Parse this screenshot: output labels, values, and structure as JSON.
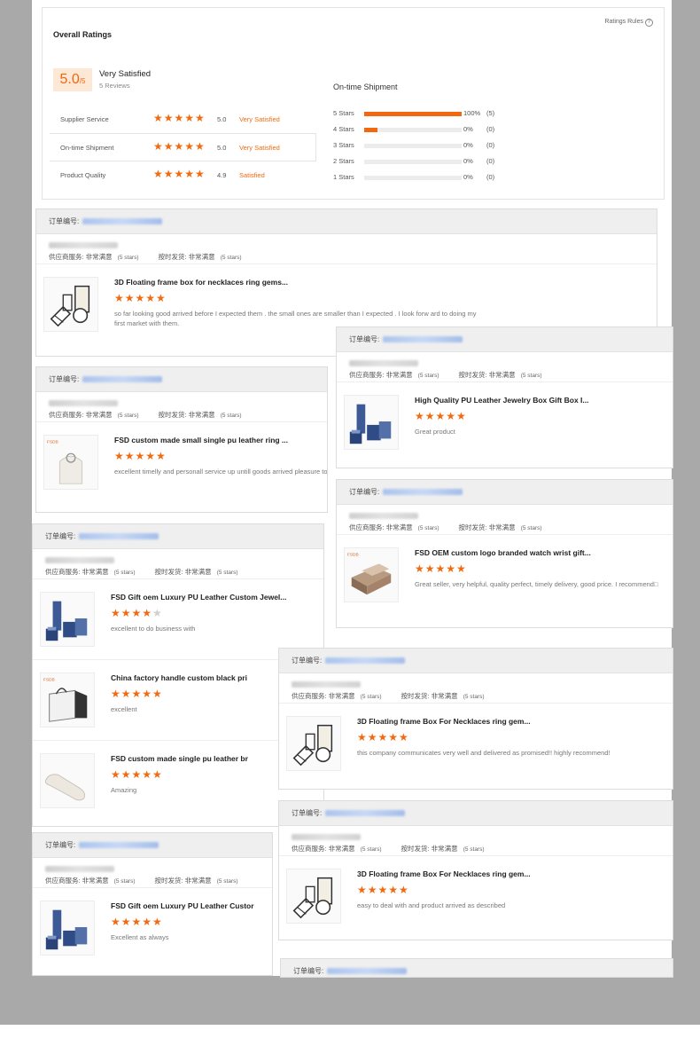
{
  "colors": {
    "accent": "#f2680f",
    "star": "#f26a10",
    "link_blur": "#aac4ee"
  },
  "overall": {
    "title": "Overall Ratings",
    "rules_label": "Ratings Rules",
    "score_main": "5.0",
    "score_den": "/5",
    "satisfaction": "Very Satisfied",
    "reviews": "5 Reviews",
    "subs": [
      {
        "name": "Supplier Service",
        "stars": "★★★★★",
        "value": "5.0",
        "text": "Very Satisfied"
      },
      {
        "name": "On-time Shipment",
        "stars": "★★★★★",
        "value": "5.0",
        "text": "Very Satisfied"
      },
      {
        "name": "Product Quality",
        "stars": "★★★★★",
        "value": "4.9",
        "text": "Satisfied"
      }
    ],
    "dist_title": "On-time Shipment",
    "dist": [
      {
        "label": "5 Stars",
        "fraction": 1.0,
        "pct": "100%",
        "count": "(5)"
      },
      {
        "label": "4 Stars",
        "fraction": 0.14,
        "pct": "0%",
        "count": "(0)"
      },
      {
        "label": "3 Stars",
        "fraction": 0,
        "pct": "0%",
        "count": "(0)"
      },
      {
        "label": "2 Stars",
        "fraction": 0,
        "pct": "0%",
        "count": "(0)"
      },
      {
        "label": "1 Stars",
        "fraction": 0,
        "pct": "0%",
        "count": "(0)"
      }
    ]
  },
  "labels": {
    "order_no": "订单编号:",
    "supplier_service": "供应商服务: 非常满意",
    "ontime": "按时发货: 非常满意",
    "five_stars": "(5 stars)"
  },
  "cards": [
    {
      "items": [
        {
          "name": "3D Floating frame box for necklaces ring gems...",
          "stars": "★★★★★",
          "stars_off": "",
          "comment": "so far looking good arrived before I expected them . the small ones are smaller than I expected . I look forw ard to doing my first market with them.",
          "icon": "frame-box-icon"
        }
      ]
    },
    {
      "items": [
        {
          "name": "FSD custom made small single pu leather ring ...",
          "stars": "★★★★★",
          "stars_off": "",
          "comment": "excellent timelly and personall service up untill goods arrived pleasure to do business with",
          "icon": "ring-stand-icon"
        }
      ]
    },
    {
      "items": [
        {
          "name": "High Quality PU Leather Jewelry Box Gift Box I...",
          "stars": "★★★★★",
          "stars_off": "",
          "comment": "Great product",
          "icon": "blue-box-icon"
        }
      ]
    },
    {
      "items": [
        {
          "name": "FSD OEM custom logo branded watch wrist gift...",
          "stars": "★★★★★",
          "stars_off": "",
          "comment": "Great seller, very helpful, quality perfect, timely delivery, good price. I recommend□",
          "icon": "watch-box-icon"
        }
      ]
    },
    {
      "items": [
        {
          "name": "FSD Gift oem Luxury PU Leather Custom Jewel...",
          "stars": "★★★★",
          "stars_off": "★",
          "comment": "excellent to do business with",
          "icon": "blue-box-icon"
        },
        {
          "name": "China factory handle custom black pri",
          "stars": "★★★★★",
          "stars_off": "",
          "comment": "excellent",
          "icon": "paper-bag-icon"
        },
        {
          "name": "FSD custom made single pu leather br",
          "stars": "★★★★★",
          "stars_off": "",
          "comment": "Amazing",
          "icon": "bracelet-holder-icon"
        }
      ]
    },
    {
      "items": [
        {
          "name": "3D Floating frame Box For Necklaces ring gem...",
          "stars": "★★★★★",
          "stars_off": "",
          "comment": "this company communicates very well and delivered as promised!! highly recommend!",
          "icon": "frame-box-icon"
        }
      ]
    },
    {
      "items": [
        {
          "name": "FSD Gift oem Luxury PU Leather Custor",
          "stars": "★★★★★",
          "stars_off": "",
          "comment": "Excellent as always",
          "icon": "blue-box-icon"
        }
      ]
    },
    {
      "items": [
        {
          "name": "3D Floating frame Box For Necklaces ring gem...",
          "stars": "★★★★★",
          "stars_off": "",
          "comment": "easy to deal with and product arrived as described",
          "icon": "frame-box-icon"
        }
      ]
    },
    {
      "items": []
    }
  ]
}
